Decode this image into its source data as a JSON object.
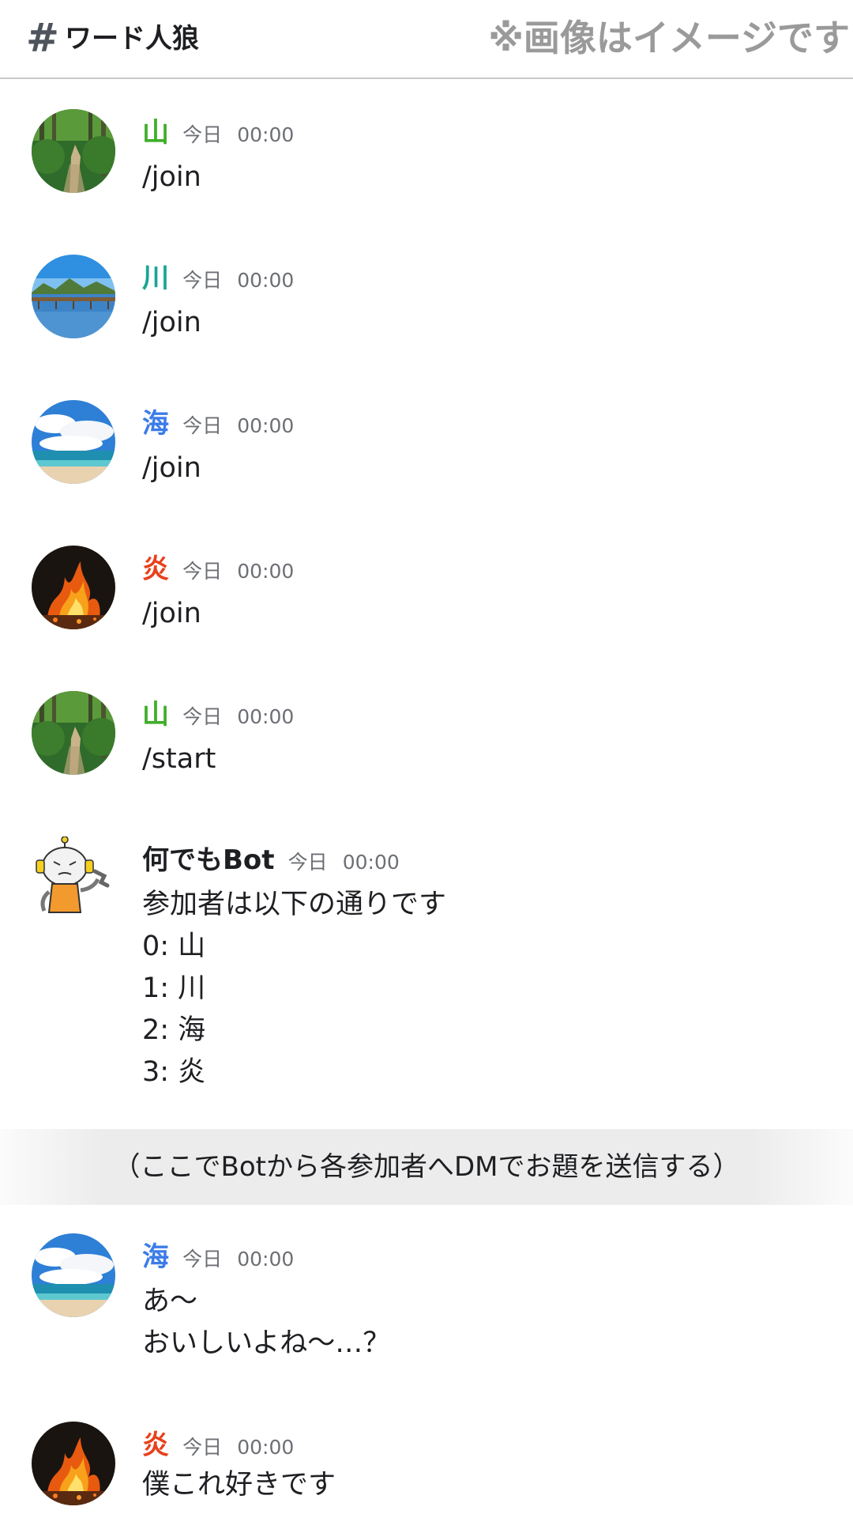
{
  "header": {
    "hash": "#",
    "channel": "ワード人狼",
    "note": "※画像はイメージです"
  },
  "colors": {
    "mountain": "#3fae29",
    "river": "#1aa595",
    "sea": "#3b7ce8",
    "flame": "#e8401c",
    "bot": "#1e1f22"
  },
  "messages": [
    {
      "author": "山",
      "day": "今日",
      "time": "00:00",
      "lines": [
        "/join"
      ],
      "avatar": "forest-path-avatar"
    },
    {
      "author": "川",
      "day": "今日",
      "time": "00:00",
      "lines": [
        "/join"
      ],
      "avatar": "river-bridge-avatar"
    },
    {
      "author": "海",
      "day": "今日",
      "time": "00:00",
      "lines": [
        "/join"
      ],
      "avatar": "beach-sky-avatar"
    },
    {
      "author": "炎",
      "day": "今日",
      "time": "00:00",
      "lines": [
        "/join"
      ],
      "avatar": "flame-avatar"
    },
    {
      "author": "山",
      "day": "今日",
      "time": "00:00",
      "lines": [
        "/start"
      ],
      "avatar": "forest-path-avatar"
    },
    {
      "author": "何でもBot",
      "day": "今日",
      "time": "00:00",
      "lines": [
        "参加者は以下の通りです",
        "0: 山",
        "1: 川",
        "2: 海",
        "3: 炎"
      ],
      "avatar": "robot-avatar"
    },
    {
      "author": "海",
      "day": "今日",
      "time": "00:00",
      "lines": [
        "あ～",
        "おいしいよね～…？"
      ],
      "avatar": "beach-sky-avatar"
    },
    {
      "author": "炎",
      "day": "今日",
      "time": "00:00",
      "lines": [
        "僕これ好きです"
      ],
      "avatar": "flame-avatar"
    }
  ],
  "divider": "（ここでBotから各参加者へDMでお題を送信する）"
}
